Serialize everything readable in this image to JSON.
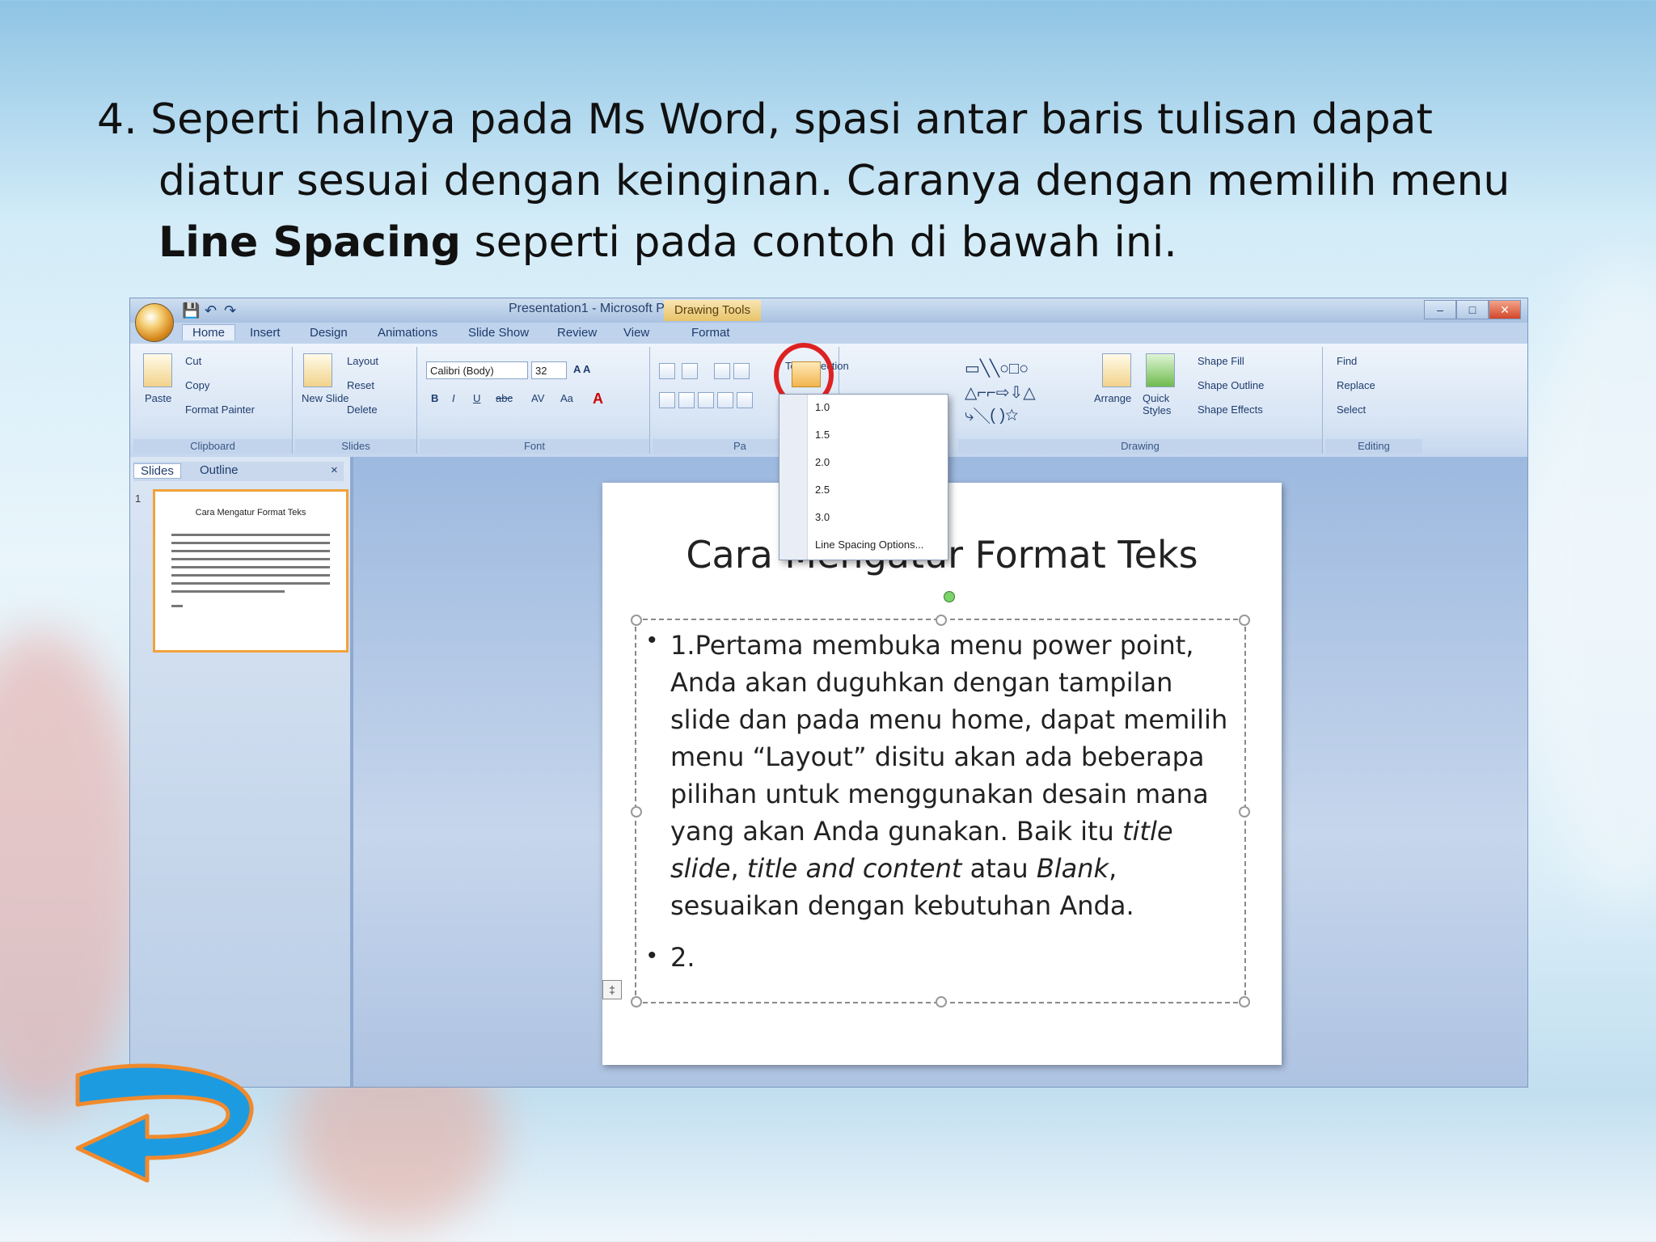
{
  "slide": {
    "instruction_line1": "4. Seperti halnya pada Ms Word, spasi antar baris tulisan dapat diatur sesuai dengan keinginan. Caranya dengan memilih menu ",
    "instruction_bold1": "Line Spacing",
    "instruction_end": " seperti pada contoh di bawah ini."
  },
  "window": {
    "title": "Presentation1 - Microsoft PowerPoint",
    "context_tab": "Drawing Tools",
    "tabs": [
      "Home",
      "Insert",
      "Design",
      "Animations",
      "Slide Show",
      "Review",
      "View",
      "Format"
    ],
    "ribbon": {
      "clipboard": {
        "paste": "Paste",
        "cut": "Cut",
        "copy": "Copy",
        "format_painter": "Format Painter",
        "label": "Clipboard"
      },
      "slides": {
        "new_slide": "New Slide",
        "layout": "Layout",
        "reset": "Reset",
        "delete": "Delete",
        "label": "Slides"
      },
      "font": {
        "font_name": "Calibri (Body)",
        "font_size": "32",
        "label": "Font"
      },
      "paragraph": {
        "text_direction": "Text Direction",
        "label": "Pa"
      },
      "drawing": {
        "arrange": "Arrange",
        "quick_styles": "Quick Styles",
        "shape_fill": "Shape Fill",
        "shape_outline": "Shape Outline",
        "shape_effects": "Shape Effects",
        "label": "Drawing"
      },
      "editing": {
        "find": "Find",
        "replace": "Replace",
        "select": "Select",
        "label": "Editing"
      }
    },
    "line_spacing_menu": {
      "options": [
        "1.0",
        "1.5",
        "2.0",
        "2.5",
        "3.0"
      ],
      "more": "Line Spacing Options..."
    },
    "pane": {
      "tab_slides": "Slides",
      "tab_outline": "Outline",
      "thumb_number": "1",
      "thumb_title": "Cara Mengatur Format Teks"
    },
    "slide_canvas": {
      "title": "Cara Mengatur Format Teks",
      "bullet1_a": "1.Pertama membuka menu power point, Anda akan duguhkan dengan tampilan slide dan pada menu home, dapat memilih menu “Layout” disitu akan ada beberapa pilihan untuk menggunakan desain mana yang akan Anda gunakan. Baik itu ",
      "bullet1_i1": "title slide",
      "bullet1_b": ", ",
      "bullet1_i2": "title and content",
      "bullet1_c": " atau ",
      "bullet1_i3": "Blank",
      "bullet1_d": ", sesuaikan dengan kebutuhan Anda.",
      "bullet2": "2."
    }
  },
  "colors": {
    "highlight_circle": "#dd2222",
    "accent_orange": "#f2a23b",
    "arrow_blue": "#1d9be0"
  }
}
